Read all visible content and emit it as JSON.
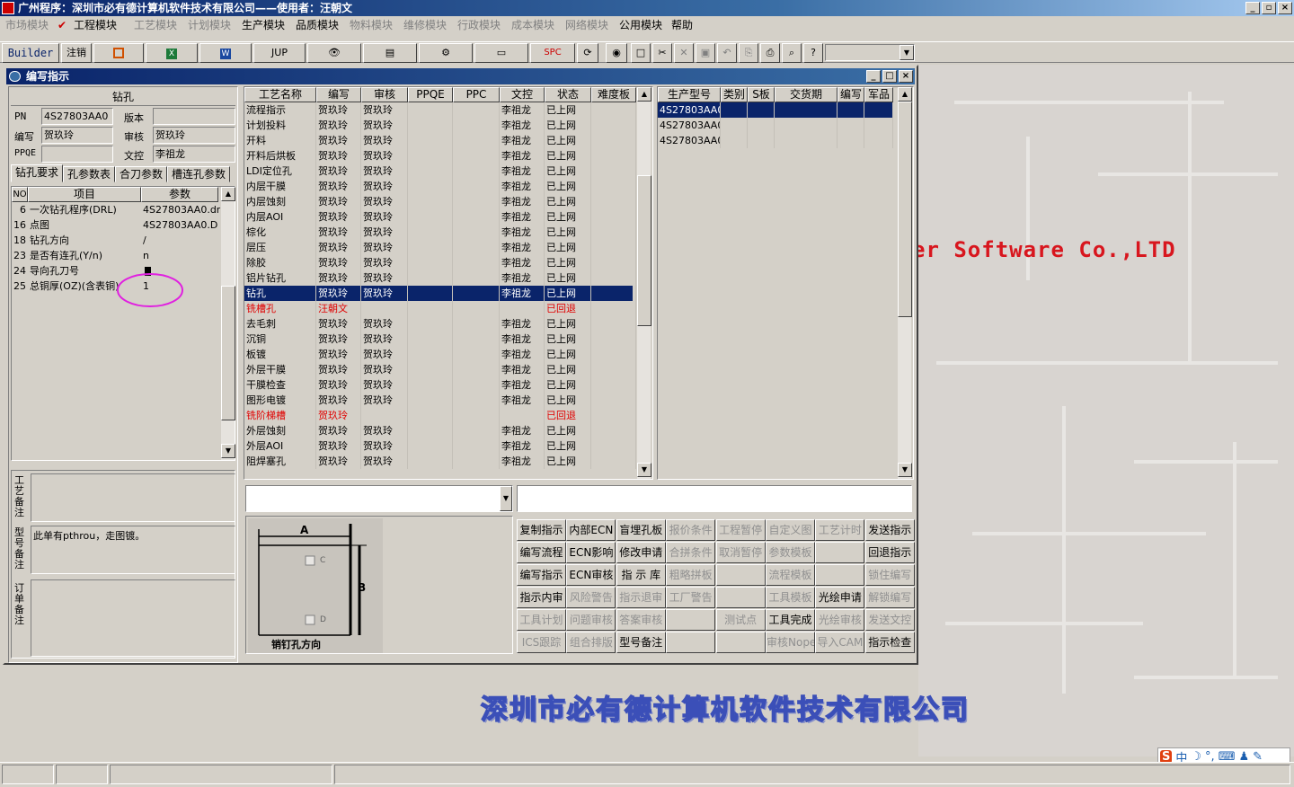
{
  "app": {
    "title": "广州程序：深圳市必有德计算机软件技术有限公司——使用者：汪朝文"
  },
  "menu": [
    {
      "label": "市场模块",
      "enabled": false
    },
    {
      "label": "工程模块",
      "enabled": true
    },
    {
      "label": "工艺模块",
      "enabled": false
    },
    {
      "label": "计划模块",
      "enabled": false
    },
    {
      "label": "生产模块",
      "enabled": true
    },
    {
      "label": "品质模块",
      "enabled": true
    },
    {
      "label": "物料模块",
      "enabled": false
    },
    {
      "label": "维修模块",
      "enabled": false
    },
    {
      "label": "行政模块",
      "enabled": false
    },
    {
      "label": "成本模块",
      "enabled": false
    },
    {
      "label": "网络模块",
      "enabled": false
    },
    {
      "label": "公用模块",
      "enabled": true
    },
    {
      "label": "帮助",
      "enabled": true
    }
  ],
  "toolbar": {
    "builder": "Builder",
    "logout": "注销",
    "jup": "JUP",
    "spc": "SPC"
  },
  "child": {
    "title": "编写指示"
  },
  "left": {
    "section_title": "钻孔",
    "pn_label": "PN",
    "pn_value": "4S27803AA0",
    "version_label": "版本",
    "version_value": "",
    "author_label": "编写",
    "author_value": "贺玖玲",
    "review_label": "审核",
    "review_value": "贺玖玲",
    "ppqe_label": "PPQE",
    "ppqe_value": "",
    "doc_label": "文控",
    "doc_value": "李祖龙",
    "tabs": [
      "钻孔要求",
      "孔参数表",
      "合刀参数",
      "槽连孔参数"
    ],
    "grid_headers": [
      "NO",
      "项目",
      "参数"
    ],
    "grid_rows": [
      {
        "no": "6",
        "item": "一次钻孔程序(DRL)",
        "param": "4S27803AA0.drl"
      },
      {
        "no": "16",
        "item": "点图",
        "param": "4S27803AA0.D"
      },
      {
        "no": "18",
        "item": "钻孔方向",
        "param": "/"
      },
      {
        "no": "23",
        "item": "是否有连孔(Y/n)",
        "param": "n"
      },
      {
        "no": "24",
        "item": "导向孔刀号",
        "param": ""
      },
      {
        "no": "25",
        "item": "总铜厚(OZ)(含表铜)",
        "param": "1"
      }
    ],
    "remark_labels": [
      "工艺备注",
      "型号备注",
      "订单备注"
    ],
    "remark_values": [
      "",
      "此单有pthrou，走图镀。",
      ""
    ]
  },
  "process": {
    "headers": [
      "工艺名称",
      "编写",
      "审核",
      "PPQE",
      "PPC",
      "文控",
      "状态",
      "难度板"
    ],
    "rows": [
      {
        "name": "流程指示",
        "author": "贺玖玲",
        "review": "贺玖玲",
        "doc": "李祖龙",
        "status": "已上网"
      },
      {
        "name": "计划投料",
        "author": "贺玖玲",
        "review": "贺玖玲",
        "doc": "李祖龙",
        "status": "已上网"
      },
      {
        "name": "开料",
        "author": "贺玖玲",
        "review": "贺玖玲",
        "doc": "李祖龙",
        "status": "已上网"
      },
      {
        "name": "开料后烘板",
        "author": "贺玖玲",
        "review": "贺玖玲",
        "doc": "李祖龙",
        "status": "已上网"
      },
      {
        "name": "LDI定位孔",
        "author": "贺玖玲",
        "review": "贺玖玲",
        "doc": "李祖龙",
        "status": "已上网"
      },
      {
        "name": "内层干膜",
        "author": "贺玖玲",
        "review": "贺玖玲",
        "doc": "李祖龙",
        "status": "已上网"
      },
      {
        "name": "内层蚀刻",
        "author": "贺玖玲",
        "review": "贺玖玲",
        "doc": "李祖龙",
        "status": "已上网"
      },
      {
        "name": "内层AOI",
        "author": "贺玖玲",
        "review": "贺玖玲",
        "doc": "李祖龙",
        "status": "已上网"
      },
      {
        "name": "棕化",
        "author": "贺玖玲",
        "review": "贺玖玲",
        "doc": "李祖龙",
        "status": "已上网"
      },
      {
        "name": "层压",
        "author": "贺玖玲",
        "review": "贺玖玲",
        "doc": "李祖龙",
        "status": "已上网"
      },
      {
        "name": "除胶",
        "author": "贺玖玲",
        "review": "贺玖玲",
        "doc": "李祖龙",
        "status": "已上网"
      },
      {
        "name": "铝片钻孔",
        "author": "贺玖玲",
        "review": "贺玖玲",
        "doc": "李祖龙",
        "status": "已上网"
      },
      {
        "name": "钻孔",
        "author": "贺玖玲",
        "review": "贺玖玲",
        "doc": "李祖龙",
        "status": "已上网",
        "selected": true
      },
      {
        "name": "铣槽孔",
        "author": "汪朝文",
        "review": "",
        "doc": "",
        "status": "已回退",
        "red": true
      },
      {
        "name": "去毛刺",
        "author": "贺玖玲",
        "review": "贺玖玲",
        "doc": "李祖龙",
        "status": "已上网"
      },
      {
        "name": "沉铜",
        "author": "贺玖玲",
        "review": "贺玖玲",
        "doc": "李祖龙",
        "status": "已上网"
      },
      {
        "name": "板镀",
        "author": "贺玖玲",
        "review": "贺玖玲",
        "doc": "李祖龙",
        "status": "已上网"
      },
      {
        "name": "外层干膜",
        "author": "贺玖玲",
        "review": "贺玖玲",
        "doc": "李祖龙",
        "status": "已上网"
      },
      {
        "name": "干膜检查",
        "author": "贺玖玲",
        "review": "贺玖玲",
        "doc": "李祖龙",
        "status": "已上网"
      },
      {
        "name": "图形电镀",
        "author": "贺玖玲",
        "review": "贺玖玲",
        "doc": "李祖龙",
        "status": "已上网"
      },
      {
        "name": "铣阶梯槽",
        "author": "贺玖玲",
        "review": "",
        "doc": "",
        "status": "已回退",
        "red": true
      },
      {
        "name": "外层蚀刻",
        "author": "贺玖玲",
        "review": "贺玖玲",
        "doc": "李祖龙",
        "status": "已上网"
      },
      {
        "name": "外层AOI",
        "author": "贺玖玲",
        "review": "贺玖玲",
        "doc": "李祖龙",
        "status": "已上网"
      },
      {
        "name": "阻焊塞孔",
        "author": "贺玖玲",
        "review": "贺玖玲",
        "doc": "李祖龙",
        "status": "已上网"
      }
    ]
  },
  "models": {
    "headers": [
      "生产型号",
      "类别",
      "S板",
      "交货期",
      "编写",
      "军品"
    ],
    "rows": [
      {
        "model": "4S27803AA0",
        "selected": true
      },
      {
        "model": "4S27803AA0"
      },
      {
        "model": "4S27803AA0"
      }
    ]
  },
  "diagram": {
    "a": "A",
    "b": "B",
    "c": "C",
    "d": "D",
    "caption": "销钉孔方向"
  },
  "buttons": [
    [
      "复制指示",
      "内部ECN",
      "盲埋孔板",
      "报价条件",
      "工程暂停",
      "自定义图",
      "工艺计时",
      "发送指示"
    ],
    [
      "编写流程",
      "ECN影响",
      "修改申请",
      "合拼条件",
      "取消暂停",
      "参数模板",
      "",
      "回退指示"
    ],
    [
      "编写指示",
      "ECN审核",
      "指 示 库",
      "粗略拼板",
      "",
      "流程模板",
      "",
      "锁住编写"
    ],
    [
      "指示内审",
      "风险警告",
      "指示退审",
      "工厂警告",
      "",
      "工具模板",
      "光绘申请",
      "解锁编写"
    ],
    [
      "工具计划",
      "问题审核",
      "答案审核",
      "",
      "测试点",
      "工具完成",
      "光绘审核",
      "发送文控"
    ],
    [
      "ICS跟踪",
      "组合排版",
      "型号备注",
      "",
      "",
      "审核Nope",
      "导入CAM",
      "指示检查"
    ]
  ],
  "buttons_disabled": [
    [
      false,
      false,
      false,
      true,
      true,
      true,
      true,
      false
    ],
    [
      false,
      false,
      false,
      true,
      true,
      true,
      true,
      false
    ],
    [
      false,
      false,
      false,
      true,
      true,
      true,
      true,
      true
    ],
    [
      false,
      true,
      true,
      true,
      true,
      true,
      false,
      true
    ],
    [
      true,
      true,
      true,
      true,
      true,
      false,
      true,
      true
    ],
    [
      true,
      true,
      false,
      true,
      true,
      true,
      true,
      false
    ]
  ],
  "watermark": {
    "en": "er Software Co.,LTD",
    "cn": "深圳市必有德计算机软件技术有限公司"
  },
  "ime": {
    "zh": "中"
  }
}
